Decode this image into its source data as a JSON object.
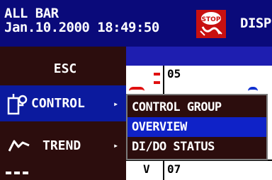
{
  "header": {
    "group_name": "ALL BAR",
    "datetime": "Jan.10.2000 18:49:50",
    "disp_label": "DISP",
    "stop_icon_label": "STOP"
  },
  "background": {
    "channel_top": "05",
    "channel_bottom": "07",
    "unit_bottom": "V"
  },
  "menu": {
    "items": [
      {
        "label": "ESC"
      },
      {
        "label": "CONTROL",
        "icon": "control-loop-icon"
      },
      {
        "label": "TREND",
        "icon": "trend-wave-icon"
      },
      {
        "label": "",
        "icon": "more-icon"
      }
    ]
  },
  "submenu": {
    "items": [
      {
        "label": "CONTROL GROUP"
      },
      {
        "label": "OVERVIEW"
      },
      {
        "label": "DI/DO STATUS"
      }
    ]
  },
  "colors": {
    "header_bg": "#0a0a7a",
    "menu_bg": "#2c0d0d",
    "highlight": "#0f22c8",
    "alarm_red": "#e01010"
  }
}
